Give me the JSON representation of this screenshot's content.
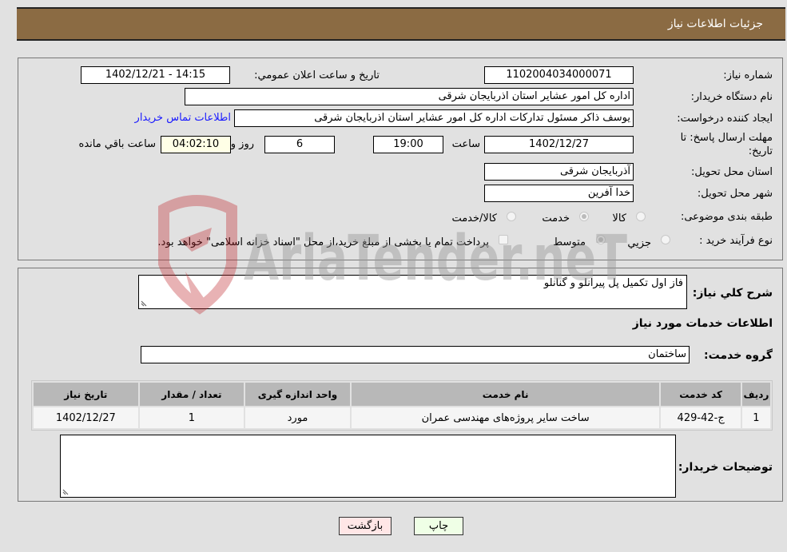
{
  "header": {
    "title": "جزئیات اطلاعات نیاز"
  },
  "form": {
    "need_number_label": "شماره نیاز:",
    "need_number": "1102004034000071",
    "announce_label": "تاریخ و ساعت اعلان عمومي:",
    "announce_value": "1402/12/21 - 14:15",
    "buyer_org_label": "نام دستگاه خریدار:",
    "buyer_org": "اداره کل امور عشایر استان اذربایجان شرقی",
    "requester_label": "ایجاد کننده درخواست:",
    "requester": "یوسف ذاکر مسئول تدارکات اداره کل امور عشایر استان اذربایجان شرقی",
    "contact_link": "اطلاعات تماس خریدار",
    "deadline_label_line1": "مهلت ارسال پاسخ: تا",
    "deadline_label_line2": "تاریخ:",
    "deadline_date": "1402/12/27",
    "time_label": "ساعت",
    "deadline_time": "19:00",
    "days_value": "6",
    "days_label": "روز و",
    "remaining_time": "04:02:10",
    "remaining_label": "ساعت باقي مانده",
    "province_label": "استان محل تحویل:",
    "province": "آذربایجان شرقی",
    "city_label": "شهر محل تحویل:",
    "city": "خدا آفرین",
    "category_label": "طبقه بندی موضوعی:",
    "category_options": [
      "کالا",
      "خدمت",
      "کالا/خدمت"
    ],
    "category_selected": "خدمت",
    "purchase_type_label": "نوع فرآیند خرید :",
    "purchase_type_options": [
      "جزیي",
      "متوسط"
    ],
    "purchase_type_selected": "متوسط",
    "payment_note": "پرداخت تمام یا بخشی از مبلغ خرید،از محل \"اسناد خزانه اسلامی\" خواهد بود.",
    "payment_note_checked": false
  },
  "details": {
    "description_label": "شرح کلي نياز:",
    "description": "فاز اول تکمیل پل پیرانلو و گنانلو",
    "services_heading": "اطلاعات خدمات مورد نياز",
    "service_group_label": "گروه خدمت:",
    "service_group": "ساختمان",
    "table": {
      "headers": [
        "رديف",
        "کد خدمت",
        "نام خدمت",
        "واحد اندازه گیری",
        "تعداد / مقدار",
        "تاریخ نیاز"
      ],
      "rows": [
        [
          "1",
          "ج-42-429",
          "ساخت سایر پروژه‌های مهندسی عمران",
          "مورد",
          "1",
          "1402/12/27"
        ]
      ]
    },
    "buyer_notes_label": "توضیحات خریدار:",
    "buyer_notes": ""
  },
  "buttons": {
    "print": "چاپ",
    "back": "بازگشت"
  },
  "watermark": {
    "text": "AriaTender.neT"
  }
}
